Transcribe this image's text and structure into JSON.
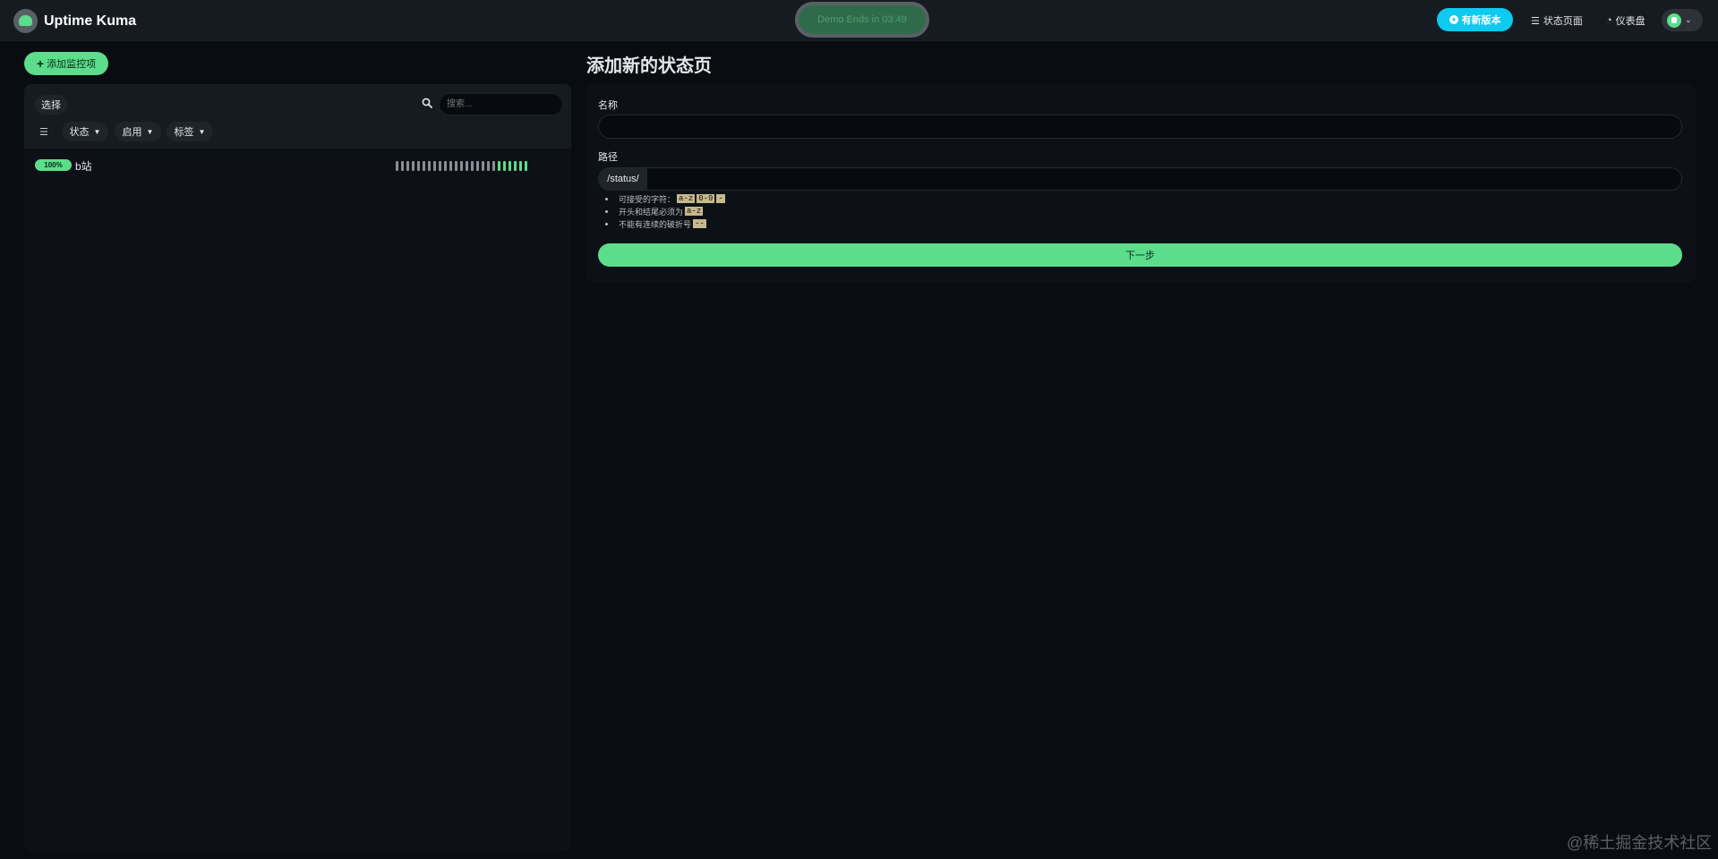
{
  "header": {
    "app_title": "Uptime Kuma",
    "demo_notice": "Demo Ends in 03:49",
    "update_label": "有新版本",
    "status_pages_label": "状态页面",
    "dashboard_label": "仪表盘"
  },
  "sidebar": {
    "add_monitor_label": "添加监控项",
    "select_label": "选择",
    "search_placeholder": "搜索...",
    "filters": {
      "status": "状态",
      "active": "启用",
      "tags": "标签"
    },
    "monitors": [
      {
        "uptime": "100%",
        "name": "b站",
        "beats": [
          "gray",
          "gray",
          "gray",
          "gray",
          "gray",
          "gray",
          "gray",
          "gray",
          "gray",
          "gray",
          "gray",
          "gray",
          "gray",
          "gray",
          "gray",
          "gray",
          "gray",
          "gray",
          "gray",
          "up",
          "up",
          "up",
          "up",
          "up",
          "up"
        ]
      }
    ]
  },
  "main": {
    "title": "添加新的状态页",
    "name_label": "名称",
    "path_label": "路径",
    "path_prefix": "/status/",
    "rules": {
      "r1_text": "可接受的字符：",
      "r1_codes": [
        "a-z",
        "0-9",
        "-"
      ],
      "r2_text": "开头和结尾必须为",
      "r2_code": "a-z",
      "r3_text": "不能有连续的破折号",
      "r3_code": "--"
    },
    "next_label": "下一步"
  },
  "watermark": "@稀土掘金技术社区",
  "colors": {
    "accent_green": "#5cdd8b",
    "accent_cyan": "#0dcaf0",
    "beat_gray": "#8a8f96"
  }
}
